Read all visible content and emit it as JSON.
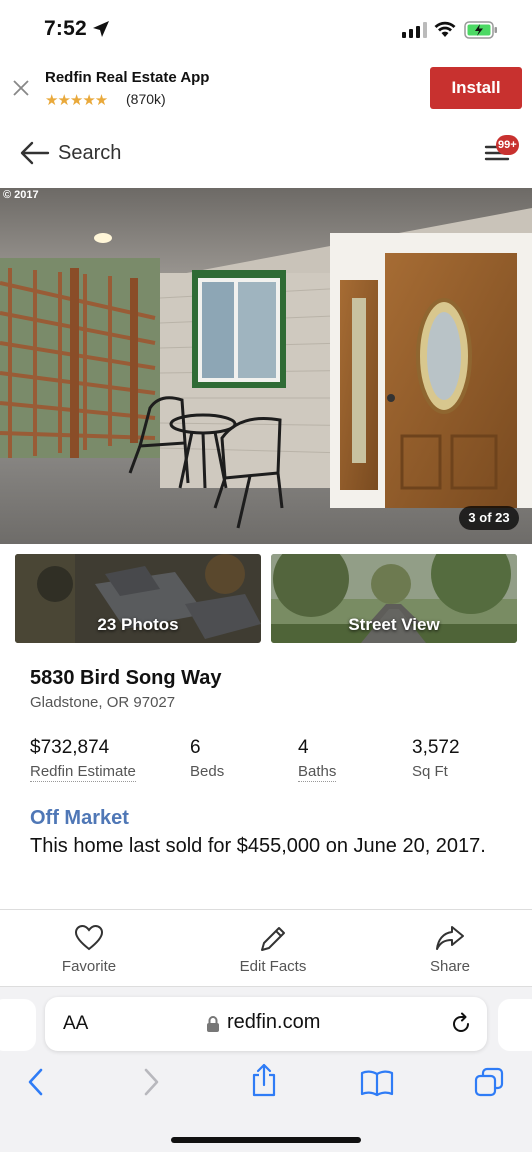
{
  "status_bar": {
    "time": "7:52"
  },
  "banner": {
    "title": "Redfin Real Estate App",
    "stars": "★★★★★",
    "rating_count": "(870k)",
    "install_label": "Install"
  },
  "nav": {
    "back_label": "Search",
    "badge": "99+"
  },
  "hero": {
    "copyright": "© 2017",
    "counter": "3 of 23"
  },
  "thumbs": {
    "photos_label": "23 Photos",
    "street_label": "Street View"
  },
  "property": {
    "address": "5830 Bird Song Way",
    "city": "Gladstone, OR 97027",
    "stats": [
      {
        "value": "$732,874",
        "label": "Redfin Estimate"
      },
      {
        "value": "6",
        "label": "Beds"
      },
      {
        "value": "4",
        "label": "Baths"
      },
      {
        "value": "3,572",
        "label": "Sq Ft"
      }
    ],
    "status": "Off Market",
    "sold_text": "This home last sold for $455,000 on June 20, 2017."
  },
  "actions": {
    "favorite": "Favorite",
    "edit": "Edit Facts",
    "share": "Share"
  },
  "browser": {
    "aa": "AA",
    "url": "redfin.com"
  },
  "colors": {
    "brand_red": "#c8312f",
    "link_blue": "#4f77b6",
    "ios_blue": "#2f7cf6"
  }
}
